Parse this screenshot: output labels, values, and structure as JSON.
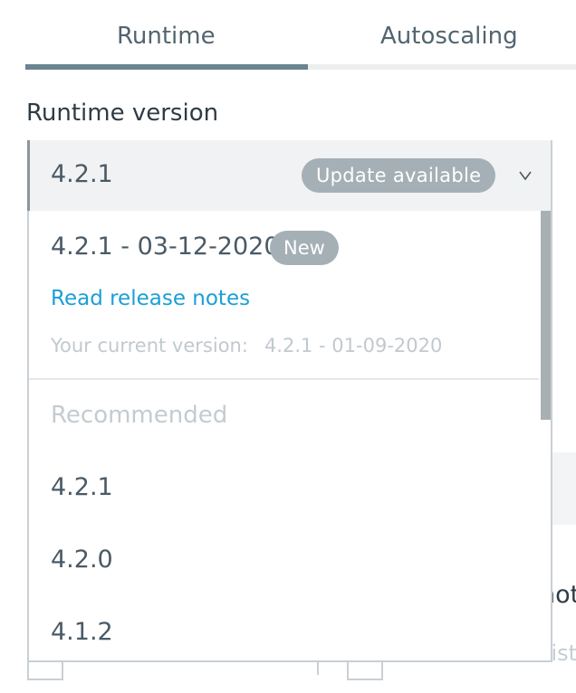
{
  "tabs": [
    {
      "label": "Runtime",
      "active": true
    },
    {
      "label": "Autoscaling",
      "active": false
    }
  ],
  "runtime_version": {
    "label": "Runtime version",
    "selected_value": "4.2.1",
    "update_badge": "Update available",
    "dropdown": {
      "new_release": {
        "version": "4.2.1 - 03-12-2020",
        "badge": "New"
      },
      "release_notes_link": "Read release notes",
      "current_version_label": "Your current version:",
      "current_version_value": "4.2.1 - 01-09-2020",
      "group_label": "Recommended",
      "options": [
        "4.2.1",
        "4.2.0",
        "4.1.2"
      ]
    }
  },
  "background": {
    "partial_text": "not",
    "faded_text": "siste"
  },
  "colors": {
    "active_tab": "#6a8490",
    "badge": "#a5b0b6",
    "link": "#1a9fd6"
  }
}
